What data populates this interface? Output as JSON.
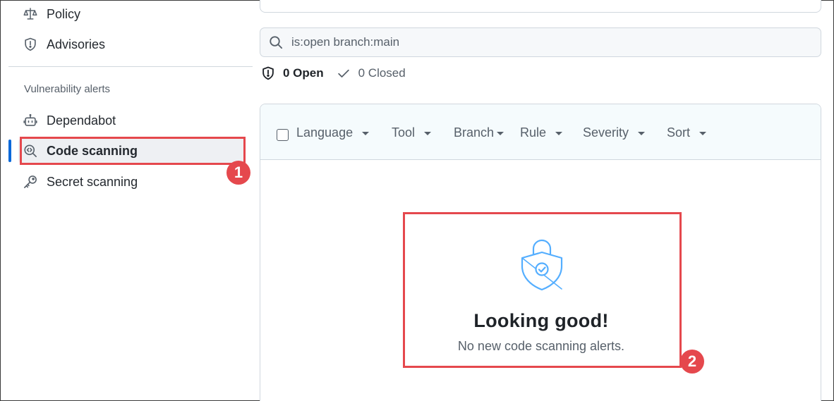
{
  "sidebar": {
    "items_top": [
      {
        "label": "Policy",
        "icon": "law-icon"
      },
      {
        "label": "Advisories",
        "icon": "shield-icon"
      }
    ],
    "section_heading": "Vulnerability alerts",
    "items": [
      {
        "label": "Dependabot",
        "icon": "dependabot-icon"
      },
      {
        "label": "Code scanning",
        "icon": "codescan-icon",
        "active": true
      },
      {
        "label": "Secret scanning",
        "icon": "key-icon"
      }
    ]
  },
  "search": {
    "value": "is:open branch:main"
  },
  "states": {
    "open_label": "0 Open",
    "closed_label": "0 Closed"
  },
  "filters": {
    "language": "Language",
    "tool": "Tool",
    "branch": "Branch",
    "rule": "Rule",
    "severity": "Severity",
    "sort": "Sort"
  },
  "blankslate": {
    "title": "Looking good!",
    "description": "No new code scanning alerts."
  },
  "callouts": {
    "first": "1",
    "second": "2"
  },
  "colors": {
    "accent": "#0969da",
    "callout": "#e5484d",
    "shield_icon": "#54aeff"
  }
}
